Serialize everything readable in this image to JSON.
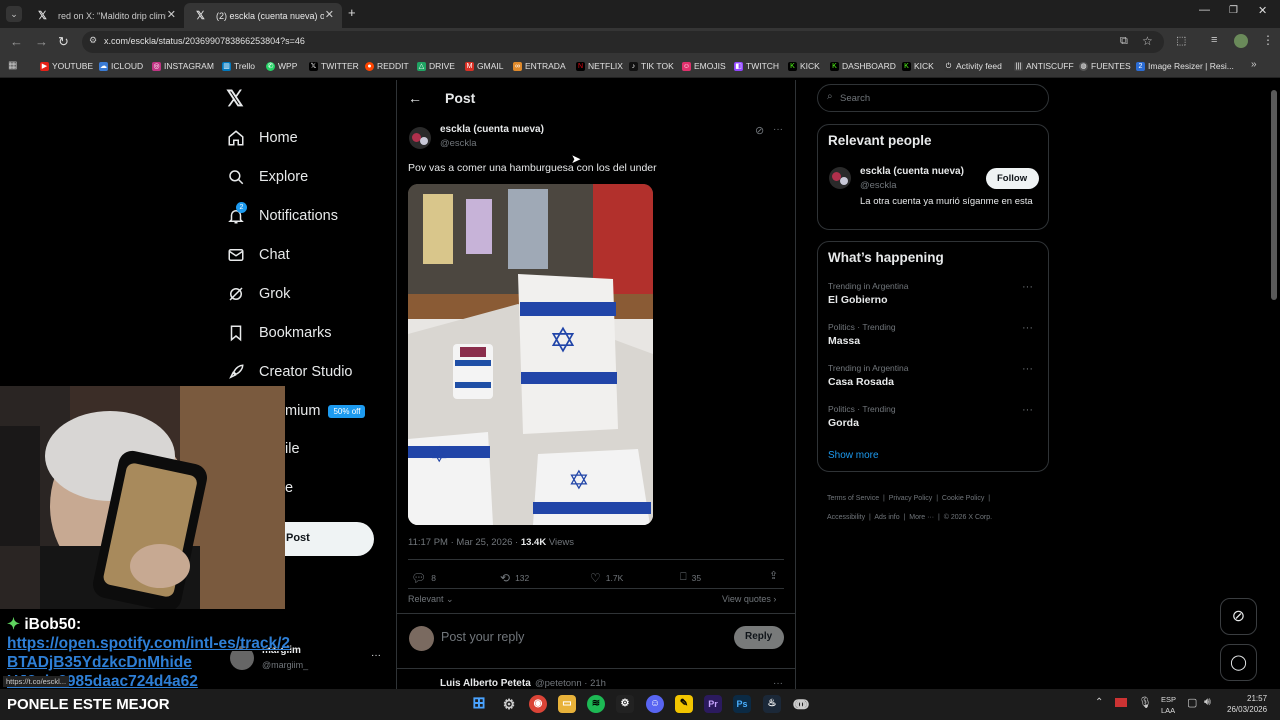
{
  "browser": {
    "tabs": [
      {
        "title": "red on X: \"Maldito drip climinal\""
      },
      {
        "title": "(2) esckla (cuenta nueva) on X:"
      }
    ],
    "url": "x.com/esckla/status/2036990783866253804?s=46",
    "bookmarks": [
      "YOUTUBE",
      "ICLOUD",
      "INSTAGRAM",
      "Trello",
      "WPP",
      "TWITTER",
      "REDDIT",
      "DRIVE",
      "GMAIL",
      "ENTRADA",
      "NETFLIX",
      "TIK TOK",
      "EMOJIS",
      "TWITCH",
      "KICK",
      "DASHBOARD",
      "KICK",
      "Activity feed",
      "ANTISCUFF",
      "FUENTES",
      "Image Resizer | Resi..."
    ],
    "status_link": "https://t.co/esckl..."
  },
  "nav": {
    "home": "Home",
    "explore": "Explore",
    "notifications": "Notifications",
    "notifications_badge": "2",
    "chat": "Chat",
    "grok": "Grok",
    "bookmarks": "Bookmarks",
    "creator_studio": "Creator Studio",
    "premium_partial": "mium",
    "premium_badge": "50% off",
    "profile_partial": "ile",
    "more_partial": "e",
    "post_button": "Post",
    "account_name": "margiim",
    "account_handle": "@margiim_"
  },
  "post": {
    "header": "Post",
    "author_name": "esckla (cuenta nueva)",
    "author_handle": "@esckla",
    "text": "Pov vas a comer una hamburguesa con los del under",
    "timestamp": "11:17 PM · Mar 25, 2026 · ",
    "views_count": "13.4K",
    "views_label": " Views",
    "replies": "8",
    "reposts": "132",
    "likes": "1.7K",
    "bookmarks": "35",
    "sort_label": "Relevant",
    "view_quotes": "View quotes",
    "reply_placeholder": "Post your reply",
    "reply_button": "Reply",
    "next_reply_name": "Luis Alberto Peteta",
    "next_reply_meta": "@petetonn · 21h"
  },
  "sidebar": {
    "search_placeholder": "Search",
    "relevant_title": "Relevant people",
    "person_name": "esckla (cuenta nueva)",
    "person_handle": "@esckla",
    "person_bio": "La otra cuenta ya murió síganme en esta",
    "follow_label": "Follow",
    "happening_title": "What’s happening",
    "trends": [
      {
        "meta": "Trending in Argentina",
        "name": "El Gobierno"
      },
      {
        "meta": "Politics · Trending",
        "name": "Massa"
      },
      {
        "meta": "Trending in Argentina",
        "name": "Casa Rosada"
      },
      {
        "meta": "Politics · Trending",
        "name": "Gorda"
      }
    ],
    "show_more": "Show more",
    "footer": [
      "Terms of Service",
      "Privacy Policy",
      "Cookie Policy",
      "Accessibility",
      "Ads info",
      "More ···",
      "© 2026 X Corp."
    ]
  },
  "overlay": {
    "chat_user": "iBob50:",
    "chat_link": "https://open.spotify.com/intl-es/track/2BTADjB35YdzkcDnMhide",
    "chat_link_tail": "UJ?si=3985daac724d4a62",
    "caption": "PONELE ESTE MEJOR"
  },
  "taskbar": {
    "lang": "ESP",
    "lang2": "LAA",
    "time": "21:57",
    "date": "26/03/2026"
  },
  "colors": {
    "accent": "#1d9bf0",
    "background": "#000000",
    "border": "#2f3336",
    "link_overlay": "#2e7fd6"
  }
}
